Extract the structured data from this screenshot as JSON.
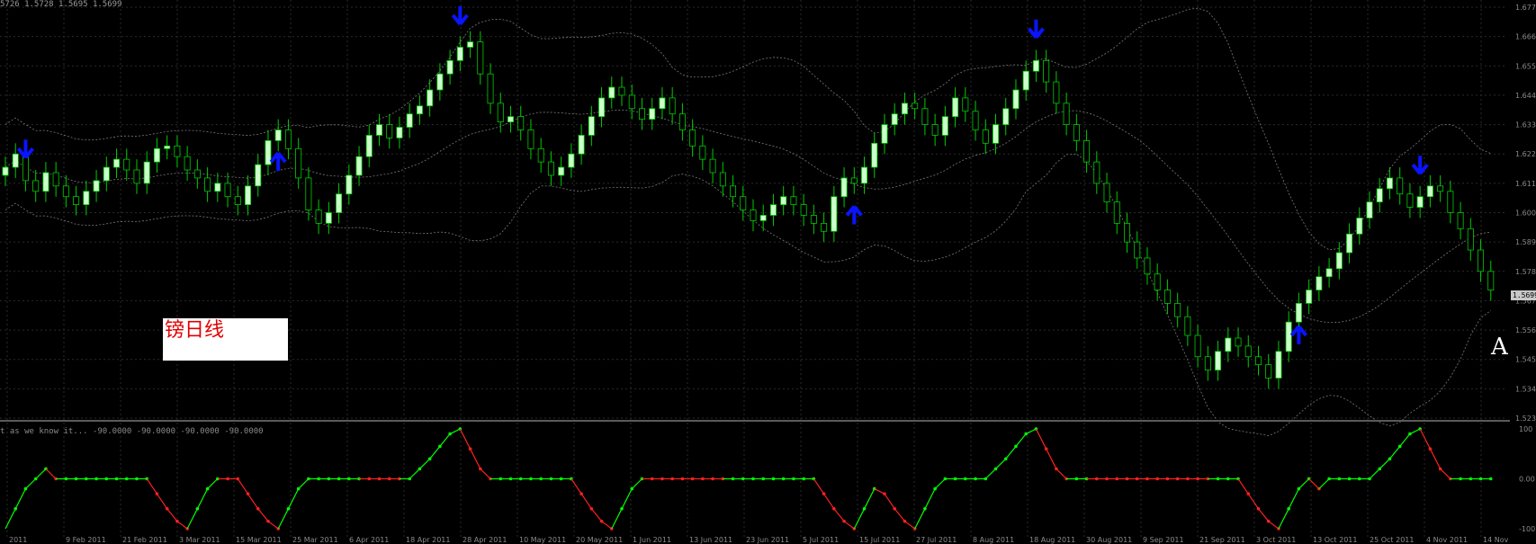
{
  "header": {
    "ohlc": "5726 1.5728 1.5695 1.5699",
    "indicator": "t as we know it... -90.0000 -90.0000 -90.0000 -90.0000"
  },
  "label_box": {
    "text": "镑日线"
  },
  "marker_text": "A",
  "colors": {
    "background": "#000000",
    "grid": "#2a2a2a",
    "bull_candle": "#ccffcc",
    "wick": "#00cc00",
    "bands": "#7a7a7a",
    "arrow": "#0a14ff",
    "osc_green": "#00ff00",
    "osc_red": "#ff2020",
    "axis_text": "#8a8a8a"
  },
  "icons": {
    "up_arrow": "arrow-up-icon",
    "down_arrow": "arrow-down-icon"
  },
  "chart_data": {
    "type": "candlestick",
    "price_axis_ticks": [
      "1.677",
      "1.666",
      "1.655",
      "1.644",
      "1.633",
      "1.622",
      "1.611",
      "1.600",
      "1.589",
      "1.578",
      "1.567",
      "1.556",
      "1.545",
      "1.534",
      "1.523"
    ],
    "current_price_label": "1.5699",
    "ylim": [
      1.523,
      1.677
    ],
    "indicator_axis_ticks": [
      "100",
      "0.00",
      "-100"
    ],
    "indicator_ylim": [
      -100,
      100
    ],
    "date_labels": [
      "2011",
      "9 Feb 2011",
      "21 Feb 2011",
      "3 Mar 2011",
      "15 Mar 2011",
      "25 Mar 2011",
      "6 Apr 2011",
      "18 Apr 2011",
      "28 Apr 2011",
      "10 May 2011",
      "20 May 2011",
      "1 Jun 2011",
      "13 Jun 2011",
      "23 Jun 2011",
      "5 Jul 2011",
      "15 Jul 2011",
      "27 Jul 2011",
      "8 Aug 2011",
      "18 Aug 2011",
      "30 Aug 2011",
      "9 Sep 2011",
      "21 Sep 2011",
      "3 Oct 2011",
      "13 Oct 2011",
      "25 Oct 2011",
      "4 Nov 2011",
      "14 Nov"
    ],
    "closes": [
      1.617,
      1.622,
      1.612,
      1.608,
      1.615,
      1.61,
      1.606,
      1.603,
      1.608,
      1.612,
      1.617,
      1.62,
      1.616,
      1.611,
      1.619,
      1.624,
      1.625,
      1.621,
      1.616,
      1.613,
      1.608,
      1.611,
      1.606,
      1.603,
      1.61,
      1.618,
      1.627,
      1.631,
      1.624,
      1.613,
      1.601,
      1.596,
      1.6,
      1.607,
      1.614,
      1.621,
      1.629,
      1.633,
      1.628,
      1.632,
      1.637,
      1.64,
      1.646,
      1.652,
      1.657,
      1.662,
      1.664,
      1.652,
      1.641,
      1.634,
      1.636,
      1.631,
      1.624,
      1.619,
      1.614,
      1.617,
      1.622,
      1.629,
      1.636,
      1.643,
      1.647,
      1.644,
      1.639,
      1.635,
      1.639,
      1.643,
      1.637,
      1.631,
      1.625,
      1.62,
      1.615,
      1.61,
      1.606,
      1.601,
      1.597,
      1.599,
      1.603,
      1.606,
      1.603,
      1.599,
      1.596,
      1.593,
      1.606,
      1.613,
      1.611,
      1.617,
      1.626,
      1.633,
      1.637,
      1.641,
      1.639,
      1.633,
      1.629,
      1.636,
      1.643,
      1.638,
      1.631,
      1.626,
      1.633,
      1.639,
      1.646,
      1.653,
      1.657,
      1.649,
      1.641,
      1.633,
      1.627,
      1.619,
      1.611,
      1.604,
      1.596,
      1.589,
      1.583,
      1.577,
      1.571,
      1.566,
      1.561,
      1.554,
      1.546,
      1.541,
      1.548,
      1.553,
      1.55,
      1.546,
      1.543,
      1.538,
      1.548,
      1.559,
      1.566,
      1.571,
      1.576,
      1.579,
      1.585,
      1.592,
      1.598,
      1.604,
      1.609,
      1.613,
      1.607,
      1.602,
      1.606,
      1.61,
      1.608,
      1.6,
      1.594,
      1.586,
      1.578,
      1.571
    ]
  }
}
